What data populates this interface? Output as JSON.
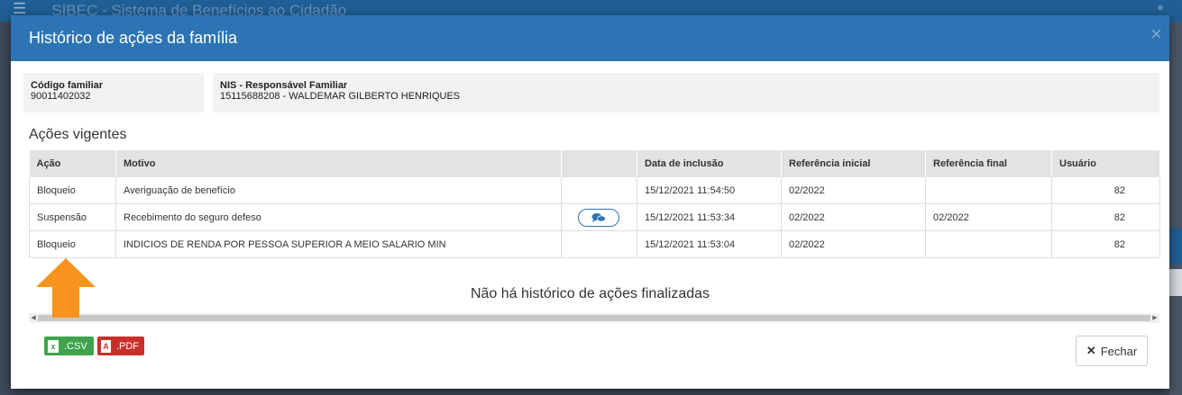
{
  "backdrop": {
    "title": "SIBEC - Sistema de Benefícios ao Cidadão"
  },
  "modal": {
    "title": "Histórico de ações da família",
    "close_glyph": "×"
  },
  "info": {
    "code_label": "Código familiar",
    "code_value": "90011402032",
    "nis_label": "NIS - Responsável Familiar",
    "nis_value": "15115688208 - WALDEMAR GILBERTO HENRIQUES"
  },
  "section_title": "Ações vigentes",
  "table": {
    "headers": [
      "Ação",
      "Motivo",
      "",
      "Data de inclusão",
      "Referência inicial",
      "Referência final",
      "Usuário"
    ],
    "rows": [
      {
        "acao": "Bloqueio",
        "motivo": "Averiguação de benefício",
        "data": "15/12/2021 11:54:50",
        "ref_ini": "02/2022",
        "ref_fim": "",
        "usuario": "82"
      },
      {
        "acao": "Suspensão",
        "motivo": "Recebimento do seguro defeso",
        "data": "15/12/2021 11:53:34",
        "ref_ini": "02/2022",
        "ref_fim": "02/2022",
        "usuario": "82"
      },
      {
        "acao": "Bloqueio",
        "motivo": "INDICIOS DE RENDA POR PESSOA SUPERIOR A MEIO SALARIO MIN",
        "data": "15/12/2021 11:53:04",
        "ref_ini": "02/2022",
        "ref_fim": "",
        "usuario": "82"
      }
    ]
  },
  "no_history": "Não há histórico de ações finalizadas",
  "buttons": {
    "csv": ".CSV",
    "pdf": ".PDF",
    "close": "Fechar"
  },
  "colors": {
    "header": "#2c74b4",
    "csv": "#3fa34d",
    "pdf": "#c9302c",
    "arrow": "#f7941d"
  },
  "icons": {
    "comment": "comments-icon",
    "arrow": "arrow-up-icon"
  }
}
